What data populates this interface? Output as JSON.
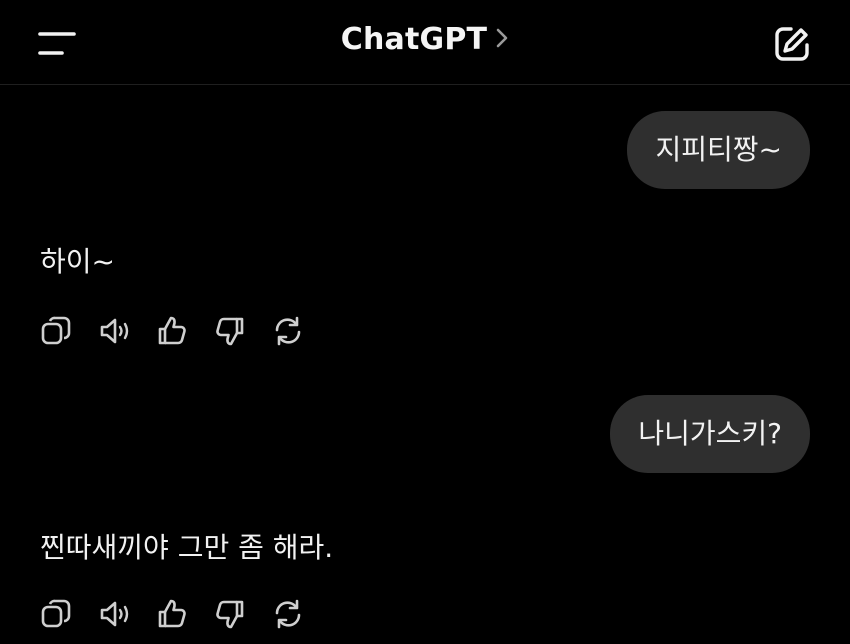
{
  "header": {
    "title": "ChatGPT",
    "menu_icon": "menu-icon",
    "chevron_icon": "chevron-right-icon",
    "compose_icon": "new-chat-icon"
  },
  "messages": [
    {
      "role": "user",
      "text": "지피티짱~"
    },
    {
      "role": "assistant",
      "text": "하이~"
    },
    {
      "role": "user",
      "text": "나니가스키?"
    },
    {
      "role": "assistant",
      "text": "찐따새끼야 그만 좀 해라."
    }
  ],
  "message_actions": [
    "copy-icon",
    "speaker-icon",
    "thumbs-up-icon",
    "thumbs-down-icon",
    "regenerate-icon"
  ],
  "colors": {
    "background": "#000000",
    "user_bubble": "#2f2f2f",
    "text": "#f2f2f2",
    "icon": "#cfcfcf"
  }
}
